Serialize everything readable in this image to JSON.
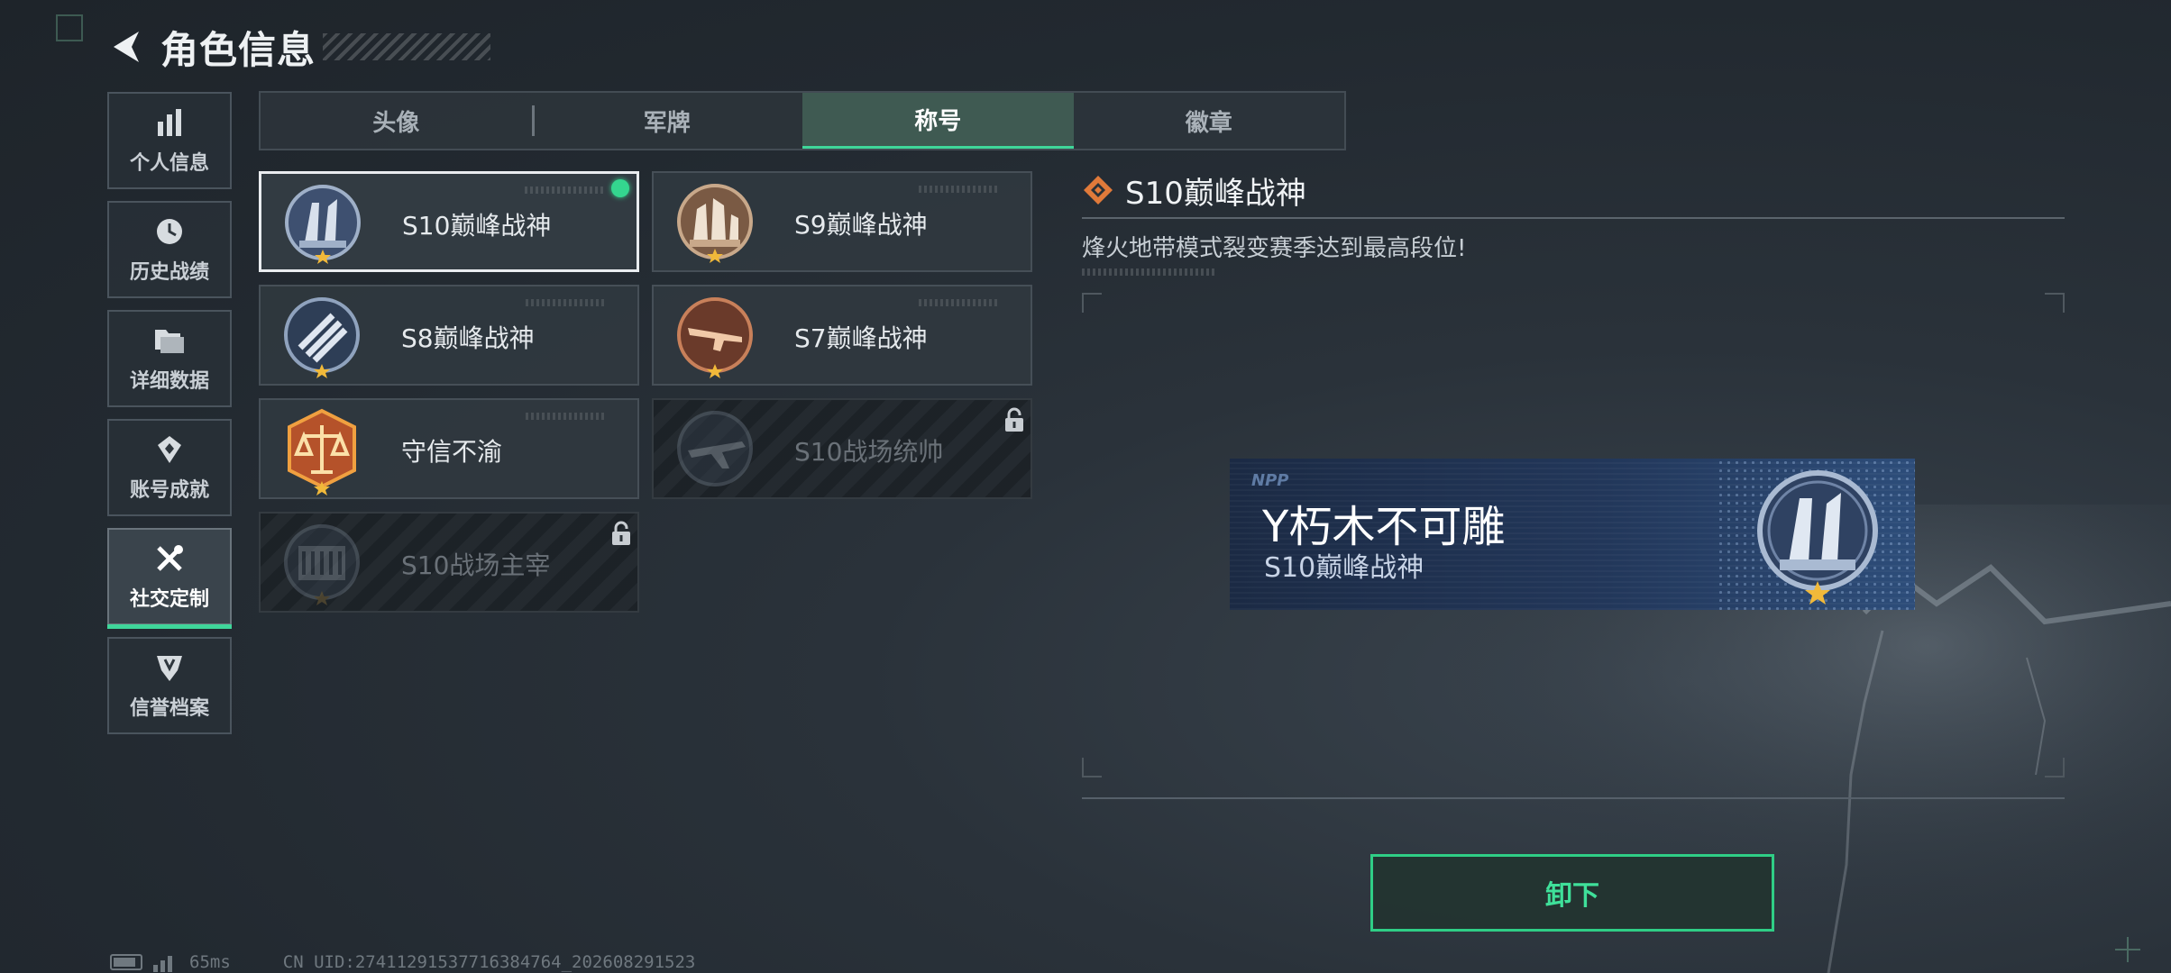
{
  "header": {
    "title": "角色信息"
  },
  "sidebar": {
    "items": [
      {
        "label": "个人信息",
        "icon": "bar-chart-icon"
      },
      {
        "label": "历史战绩",
        "icon": "clock-icon"
      },
      {
        "label": "详细数据",
        "icon": "folder-icon"
      },
      {
        "label": "账号成就",
        "icon": "achievement-icon"
      },
      {
        "label": "社交定制",
        "icon": "wrench-screwdriver-icon",
        "active": true
      },
      {
        "label": "信誉档案",
        "icon": "shield-icon"
      }
    ]
  },
  "tabs": [
    {
      "label": "头像"
    },
    {
      "label": "军牌"
    },
    {
      "label": "称号",
      "active": true
    },
    {
      "label": "徽章"
    }
  ],
  "titles": [
    {
      "name": "S10巅峰战神",
      "selected": true,
      "equipped": true,
      "locked": false,
      "emblem": "tower-emblem"
    },
    {
      "name": "S9巅峰战神",
      "selected": false,
      "equipped": false,
      "locked": false,
      "emblem": "ruins-emblem"
    },
    {
      "name": "S8巅峰战神",
      "selected": false,
      "equipped": false,
      "locked": false,
      "emblem": "stripes-emblem"
    },
    {
      "name": "S7巅峰战神",
      "selected": false,
      "equipped": false,
      "locked": false,
      "emblem": "rifle-emblem"
    },
    {
      "name": "守信不渝",
      "selected": false,
      "equipped": false,
      "locked": false,
      "emblem": "scales-emblem"
    },
    {
      "name": "S10战场统帅",
      "selected": false,
      "equipped": false,
      "locked": true,
      "emblem": "aircraft-emblem"
    },
    {
      "name": "S10战场主宰",
      "selected": false,
      "equipped": false,
      "locked": true,
      "emblem": "colosseum-emblem"
    }
  ],
  "detail": {
    "title": "S10巅峰战神",
    "description": "烽火地带模式裂变赛季达到最高段位!"
  },
  "namecard": {
    "logo": "NPP",
    "player_name": "Y朽木不可雕",
    "player_title": "S10巅峰战神"
  },
  "unequip_button": {
    "label": "卸下"
  },
  "status": {
    "ping": "65ms",
    "uid": "CN UID:27411291537716384764_202608291523"
  },
  "colors": {
    "accent": "#3fd69a",
    "background": "#252c33",
    "namecard": "#22375a"
  }
}
